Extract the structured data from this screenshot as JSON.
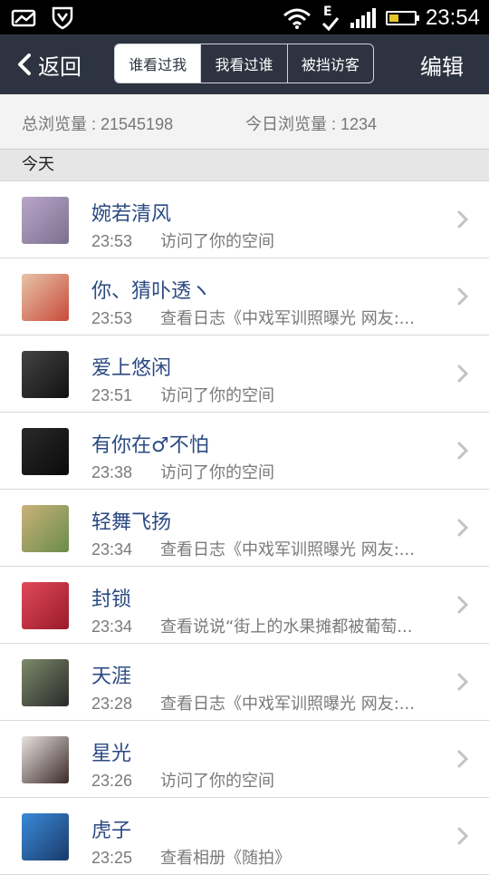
{
  "status_bar": {
    "time": "23:54",
    "icons": [
      "photo-icon",
      "shield-icon",
      "wifi-icon",
      "edge-e-icon",
      "signal-icon",
      "battery-icon"
    ],
    "battery_color": "#e6c62a"
  },
  "navbar": {
    "back_label": "返回",
    "edit_label": "编辑",
    "tabs": [
      {
        "label": "谁看过我",
        "active": true
      },
      {
        "label": "我看过谁",
        "active": false
      },
      {
        "label": "被挡访客",
        "active": false
      }
    ]
  },
  "stats": {
    "total": "总浏览量 : 21545198",
    "today": "今日浏览量 : 1234"
  },
  "section": {
    "title": "今天"
  },
  "visitors": [
    {
      "name": "婉若清风",
      "time": "23:53",
      "action": "访问了你的空间",
      "avatar_colors": [
        "#b8a6c8",
        "#7d6f8f"
      ]
    },
    {
      "name": "你、猜卟透ヽ",
      "time": "23:53",
      "action": "查看日志《中戏军训照曝光 网友:...",
      "avatar_colors": [
        "#e7c4a8",
        "#c94a3a"
      ]
    },
    {
      "name": "爱上悠闲",
      "time": "23:51",
      "action": "访问了你的空间",
      "avatar_colors": [
        "#444444",
        "#111111"
      ]
    },
    {
      "name": "有你在♂不怕",
      "time": "23:38",
      "action": "访问了你的空间",
      "avatar_colors": [
        "#2a2a2a",
        "#0a0a0a"
      ]
    },
    {
      "name": "轻舞飞扬",
      "time": "23:34",
      "action": "查看日志《中戏军训照曝光 网友:...",
      "avatar_colors": [
        "#c9b27a",
        "#6a8c4a"
      ]
    },
    {
      "name": "封锁",
      "time": "23:34",
      "action": "查看说说“街上的水果摊都被葡萄...",
      "avatar_colors": [
        "#e04a5a",
        "#9a1a2a"
      ]
    },
    {
      "name": "天涯",
      "time": "23:28",
      "action": "查看日志《中戏军训照曝光 网友:...",
      "avatar_colors": [
        "#7d8a6a",
        "#2a2a2a"
      ]
    },
    {
      "name": "星光",
      "time": "23:26",
      "action": "访问了你的空间",
      "avatar_colors": [
        "#e8e2e0",
        "#3a2a2a"
      ]
    },
    {
      "name": "虎子",
      "time": "23:25",
      "action": "查看相册《随拍》",
      "avatar_colors": [
        "#3a8ad8",
        "#1a3a6a"
      ]
    }
  ]
}
